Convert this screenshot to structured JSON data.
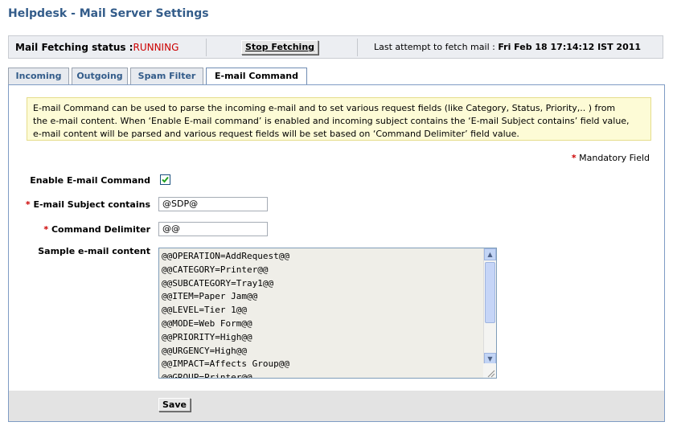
{
  "page": {
    "title": "Helpdesk - Mail Server Settings"
  },
  "status": {
    "label": "Mail Fetching status :",
    "value": "RUNNING",
    "stop_button": "Stop Fetching",
    "last_attempt_label": "Last attempt to fetch mail : ",
    "last_attempt_value": "Fri Feb 18 17:14:12 IST 2011"
  },
  "tabs": [
    {
      "label": "Incoming",
      "active": false
    },
    {
      "label": "Outgoing",
      "active": false
    },
    {
      "label": "Spam Filter",
      "active": false
    },
    {
      "label": "E-mail Command",
      "active": true
    }
  ],
  "info": {
    "line1": "E-mail Command can be used to parse the incoming e-mail and to set various request fields (like Category, Status, Priority,.. ) from",
    "line2": "the e-mail content. When ‘Enable E-mail command’ is enabled and incoming subject contains the ‘E-mail Subject contains’ field value,",
    "line3": "e-mail content will be parsed and various request fields will be set based on ‘Command Delimiter’ field value."
  },
  "form": {
    "mandatory_note": "Mandatory Field",
    "enable_label": "Enable E-mail Command",
    "enable_checked": true,
    "subject_label": "E-mail Subject contains",
    "subject_value": "@SDP@",
    "delimiter_label": "Command Delimiter",
    "delimiter_value": "@@",
    "sample_label": "Sample e-mail content",
    "sample_lines": [
      "@@OPERATION=AddRequest@@",
      "@@CATEGORY=Printer@@",
      "@@SUBCATEGORY=Tray1@@",
      "@@ITEM=Paper Jam@@",
      "@@LEVEL=Tier 1@@",
      "@@MODE=Web Form@@",
      "@@PRIORITY=High@@",
      "@@URGENCY=High@@",
      "@@IMPACT=Affects Group@@",
      "@@GROUP=Printer@@"
    ]
  },
  "save_button": "Save",
  "colors": {
    "title": "#335c8a",
    "running": "#cc0000",
    "info_bg": "#fdfbd6",
    "panel_border": "#7f9cc4"
  }
}
